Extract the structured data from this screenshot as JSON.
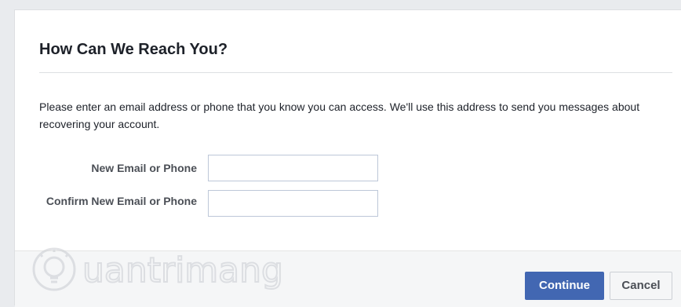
{
  "dialog": {
    "title": "How Can We Reach You?",
    "description": "Please enter an email address or phone that you know you can access. We'll use this address to send you messages about recovering your account.",
    "fields": [
      {
        "label": "New Email or Phone",
        "value": "",
        "placeholder": ""
      },
      {
        "label": "Confirm New Email or Phone",
        "value": "",
        "placeholder": ""
      }
    ],
    "buttons": {
      "continue_label": "Continue",
      "cancel_label": "Cancel"
    }
  },
  "watermark": {
    "text": "uantrimang"
  },
  "colors": {
    "primary": "#4267b2",
    "page_background": "#e9ebee",
    "footer_background": "#f5f6f7",
    "divider": "#dddfe2",
    "text": "#1d2129",
    "label_text": "#4b4f56"
  },
  "icons": {
    "watermark_logo": "bulb-icon"
  }
}
